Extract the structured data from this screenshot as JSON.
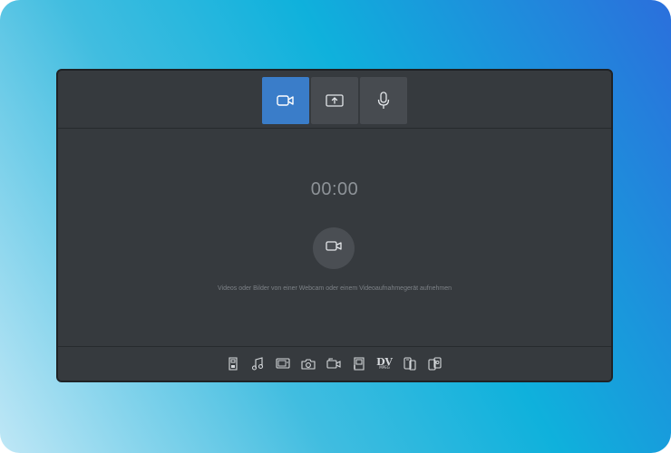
{
  "capture_modes": {
    "video_icon": "video-camera-icon",
    "screen_icon": "screen-share-icon",
    "audio_icon": "microphone-icon",
    "active": "video"
  },
  "main": {
    "timer": "00:00",
    "record_icon": "video-camera-icon",
    "hint": "Videos oder Bilder von einer Webcam oder einem Videoaufnahmegerät aufnehmen"
  },
  "devices": [
    {
      "icon": "sd-card-icon"
    },
    {
      "icon": "music-note-icon"
    },
    {
      "icon": "tv-icon"
    },
    {
      "icon": "photo-camera-icon"
    },
    {
      "icon": "camcorder-icon"
    },
    {
      "icon": "memory-card-icon"
    },
    {
      "icon": "dv-mpeg-icon",
      "label": "DV",
      "sublabel": "MPEG"
    },
    {
      "icon": "mobile-phone-icon"
    },
    {
      "icon": "mobile-devices-icon"
    }
  ],
  "colors": {
    "accent": "#3a7dc9",
    "panel": "#363a3e"
  }
}
